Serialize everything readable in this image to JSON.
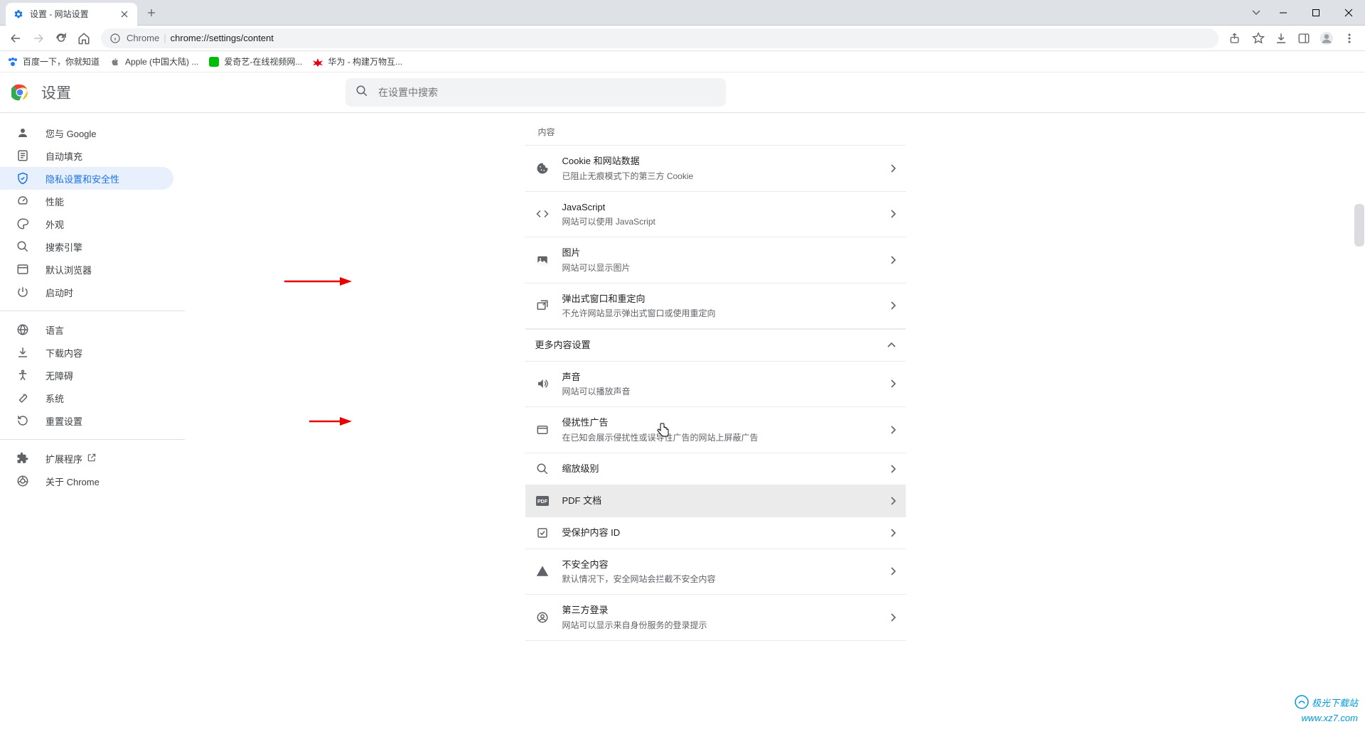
{
  "tab": {
    "title": "设置 - 网站设置"
  },
  "url": {
    "host": "Chrome",
    "path": "chrome://settings/content"
  },
  "bookmarks": [
    {
      "label": "百度一下，你就知道",
      "color": "#2878ff"
    },
    {
      "label": "Apple (中国大陆) ...",
      "color": "#808080"
    },
    {
      "label": "爱奇艺-在线视频网...",
      "color": "#00be06"
    },
    {
      "label": "华为 - 构建万物互...",
      "color": "#e60012"
    }
  ],
  "settings": {
    "title": "设置",
    "search_placeholder": "在设置中搜索"
  },
  "sidebar": {
    "items_top": [
      {
        "label": "您与 Google",
        "icon": "person"
      },
      {
        "label": "自动填充",
        "icon": "autofill"
      },
      {
        "label": "隐私设置和安全性",
        "icon": "shield",
        "active": true
      },
      {
        "label": "性能",
        "icon": "speed"
      },
      {
        "label": "外观",
        "icon": "palette"
      },
      {
        "label": "搜索引擎",
        "icon": "search"
      },
      {
        "label": "默认浏览器",
        "icon": "browser"
      },
      {
        "label": "启动时",
        "icon": "power"
      }
    ],
    "items_mid": [
      {
        "label": "语言",
        "icon": "globe"
      },
      {
        "label": "下载内容",
        "icon": "download"
      },
      {
        "label": "无障碍",
        "icon": "accessibility"
      },
      {
        "label": "系统",
        "icon": "wrench"
      },
      {
        "label": "重置设置",
        "icon": "reset"
      }
    ],
    "items_bottom": [
      {
        "label": "扩展程序",
        "icon": "extension",
        "external": true
      },
      {
        "label": "关于 Chrome",
        "icon": "chrome"
      }
    ]
  },
  "content": {
    "section_title": "内容",
    "rows_main": [
      {
        "icon": "cookie",
        "title": "Cookie 和网站数据",
        "sub": "已阻止无痕模式下的第三方 Cookie"
      },
      {
        "icon": "code",
        "title": "JavaScript",
        "sub": "网站可以使用 JavaScript"
      },
      {
        "icon": "image",
        "title": "图片",
        "sub": "网站可以显示图片"
      },
      {
        "icon": "popup",
        "title": "弹出式窗口和重定向",
        "sub": "不允许网站显示弹出式窗口或使用重定向"
      }
    ],
    "more_title": "更多内容设置",
    "rows_more": [
      {
        "icon": "sound",
        "title": "声音",
        "sub": "网站可以播放声音"
      },
      {
        "icon": "ads",
        "title": "侵扰性广告",
        "sub": "在已知会展示侵扰性或误导性广告的网站上屏蔽广告"
      },
      {
        "icon": "zoom",
        "title": "缩放级别",
        "sub": ""
      },
      {
        "icon": "pdf",
        "title": "PDF 文档",
        "sub": "",
        "hovered": true
      },
      {
        "icon": "protected",
        "title": "受保护内容 ID",
        "sub": ""
      },
      {
        "icon": "warning",
        "title": "不安全内容",
        "sub": "默认情况下，安全网站会拦截不安全内容"
      },
      {
        "icon": "federated",
        "title": "第三方登录",
        "sub": "网站可以显示来自身份服务的登录提示"
      }
    ]
  },
  "watermark": {
    "line1": "极光下载站",
    "line2": "www.xz7.com"
  }
}
